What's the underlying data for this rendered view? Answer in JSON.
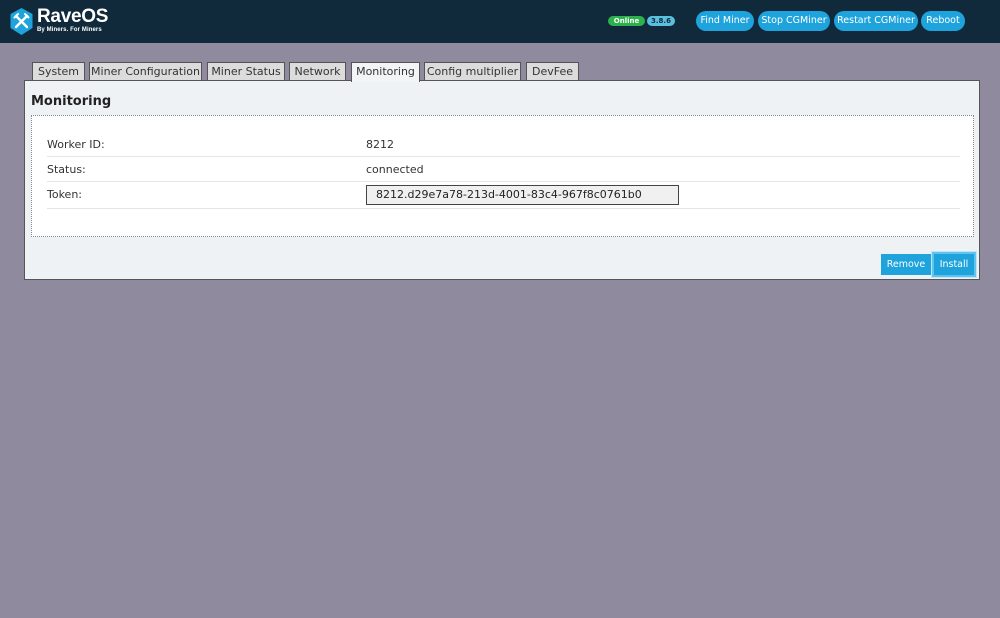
{
  "header": {
    "brand": "RaveOS",
    "tagline": "By Miners. For Miners",
    "status": "Online",
    "version": "3.8.6",
    "buttons": [
      "Find Miner",
      "Stop CGMiner",
      "Restart CGMiner",
      "Reboot"
    ]
  },
  "tabs": [
    "System",
    "Miner Configuration",
    "Miner Status",
    "Network",
    "Monitoring",
    "Config multiplier",
    "DevFee"
  ],
  "active_tab": "Monitoring",
  "panel": {
    "title": "Monitoring",
    "rows": [
      {
        "label": "Worker ID:",
        "value": "8212"
      },
      {
        "label": "Status:",
        "value": "connected"
      },
      {
        "label": "Token:",
        "value": "8212.d29e7a78-213d-4001-83c4-967f8c0761b0"
      }
    ],
    "remove_label": "Remove",
    "install_label": "Install"
  },
  "colors": {
    "header_bg": "#102a3b",
    "accent": "#1fa3dc",
    "online": "#2bb24c",
    "page_bg": "#908a9e"
  }
}
